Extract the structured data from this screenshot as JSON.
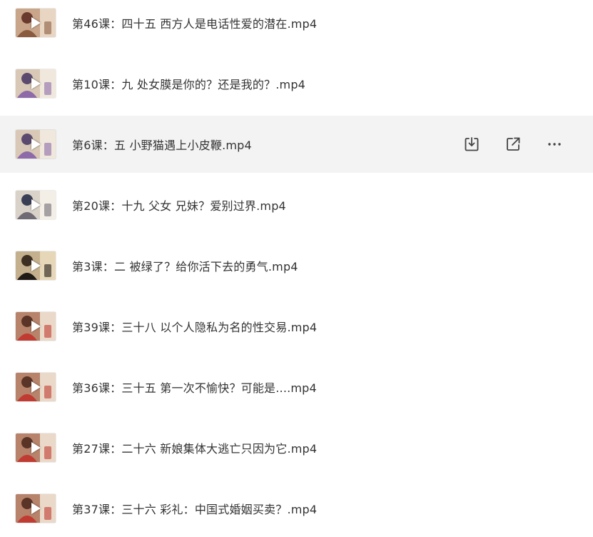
{
  "files": [
    {
      "name": "第46课：四十五 西方人是电话性爱的潜在.mp4",
      "active": false,
      "thumb": "a"
    },
    {
      "name": "第10课：九 处女膜是你的？还是我的？.mp4",
      "active": false,
      "thumb": "b"
    },
    {
      "name": "第6课：五 小野猫遇上小皮鞭.mp4",
      "active": true,
      "thumb": "b"
    },
    {
      "name": "第20课：十九 父女 兄妹？爱别过界.mp4",
      "active": false,
      "thumb": "c"
    },
    {
      "name": "第3课：二 被绿了？给你活下去的勇气.mp4",
      "active": false,
      "thumb": "d"
    },
    {
      "name": "第39课：三十八 以个人隐私为名的性交易.mp4",
      "active": false,
      "thumb": "e"
    },
    {
      "name": "第36课：三十五 第一次不愉快？可能是....mp4",
      "active": false,
      "thumb": "e"
    },
    {
      "name": "第27课：二十六 新娘集体大逃亡只因为它.mp4",
      "active": false,
      "thumb": "e"
    },
    {
      "name": "第37课：三十六 彩礼：中国式婚姻买卖？.mp4",
      "active": false,
      "thumb": "e"
    }
  ],
  "row_actions": {
    "download_icon": "download-icon",
    "share_icon": "share-icon",
    "more_icon": "more-icon"
  },
  "colors": {
    "active_row_bg": "#f3f3f3",
    "text": "#333333",
    "icon": "#444444"
  }
}
